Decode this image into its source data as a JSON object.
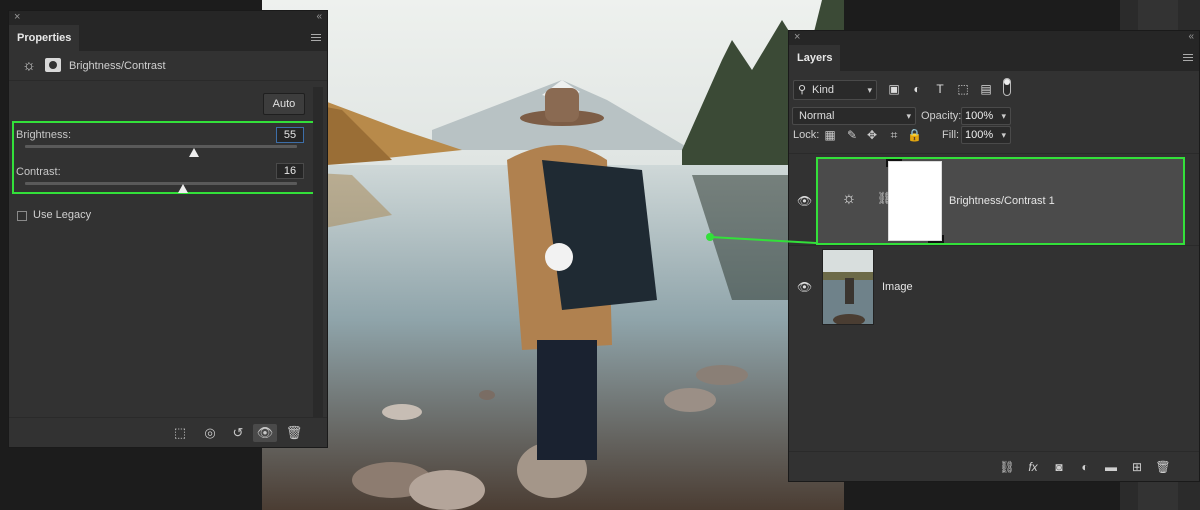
{
  "colors": {
    "highlight": "#33e03a",
    "panel": "#323232",
    "panel_dark": "#262626"
  },
  "icons": {
    "close": "×",
    "collapse": "«",
    "sun": "☼",
    "search": "🔍",
    "eye": "👁",
    "link": "⛓",
    "lock": "🔒",
    "move": "✥",
    "brush": "✎",
    "trash": "🗑",
    "reset": "↺",
    "fx": "fx"
  },
  "properties_panel": {
    "tab": "Properties",
    "adjustment_title": "Brightness/Contrast",
    "auto_button": "Auto",
    "brightness": {
      "label": "Brightness:",
      "value": "55",
      "position": 0.62
    },
    "contrast": {
      "label": "Contrast:",
      "value": "16",
      "position": 0.58
    },
    "use_legacy": {
      "label": "Use Legacy",
      "checked": false
    }
  },
  "layers_panel": {
    "tab": "Layers",
    "filter_kind": "Kind",
    "blend_mode": "Normal",
    "opacity_label": "Opacity:",
    "opacity_value": "100%",
    "lock_label": "Lock:",
    "fill_label": "Fill:",
    "fill_value": "100%",
    "layers": [
      {
        "name": "Brightness/Contrast 1",
        "type": "adjustment",
        "selected": true,
        "visible": true
      },
      {
        "name": "Image",
        "type": "pixel",
        "selected": false,
        "visible": true
      }
    ]
  }
}
